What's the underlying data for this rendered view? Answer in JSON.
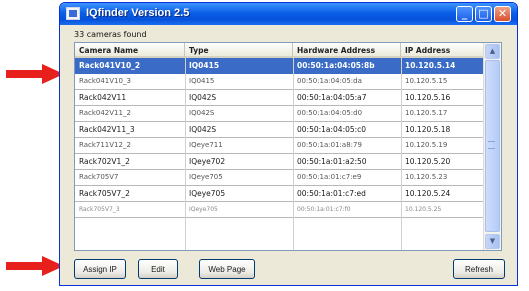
{
  "window": {
    "title": "IQfinder Version 2.5",
    "controls": {
      "minimize": "_",
      "maximize": "□",
      "close": "✕"
    }
  },
  "count_label": "33 cameras found",
  "table": {
    "columns": [
      "Camera Name",
      "Type",
      "Hardware Address",
      "IP Address"
    ],
    "rows": [
      {
        "name": "Rack041V10_2",
        "type": "IQ0415",
        "mac": "00:50:1a:04:05:8b",
        "ip": "10.120.5.14",
        "selected": true
      },
      {
        "name": "Rack041V10_3",
        "type": "IQ0415",
        "mac": "00:50:1a:04:05:da",
        "ip": "10.120.5.15"
      },
      {
        "name": "Rack042V11",
        "type": "IQ042S",
        "mac": "00:50:1a:04:05:a7",
        "ip": "10.120.5.16"
      },
      {
        "name": "Rack042V11_2",
        "type": "IQ042S",
        "mac": "00:50:1a:04:05:d0",
        "ip": "10.120.5.17"
      },
      {
        "name": "Rack042V11_3",
        "type": "IQ042S",
        "mac": "00:50:1a:04:05:c0",
        "ip": "10.120.5.18"
      },
      {
        "name": "Rack711V12_2",
        "type": "IQeye711",
        "mac": "00:50:1a:01:a8:79",
        "ip": "10.120.5.19"
      },
      {
        "name": "Rack702V1_2",
        "type": "IQeye702",
        "mac": "00:50:1a:01:a2:50",
        "ip": "10.120.5.20"
      },
      {
        "name": "Rack705V7",
        "type": "IQeye705",
        "mac": "00:50:1a:01:c7:e9",
        "ip": "10.120.5.23"
      },
      {
        "name": "Rack705V7_2",
        "type": "IQeye705",
        "mac": "00:50:1a:01:c7:ed",
        "ip": "10.120.5.24"
      },
      {
        "name": "Rack705V7_3",
        "type": "IQeye705",
        "mac": "00:50:1a:01:c7:f0",
        "ip": "10.120.5.25"
      }
    ]
  },
  "scrollbar": {
    "up": "▲",
    "down": "▼"
  },
  "buttons": {
    "assign_ip": "Assign IP",
    "edit": "Edit",
    "web_page": "Web Page",
    "refresh": "Refresh"
  },
  "colors": {
    "titlebar": "#0a5fe6",
    "selection": "#3a6bc6",
    "arrow": "#e8201c"
  }
}
